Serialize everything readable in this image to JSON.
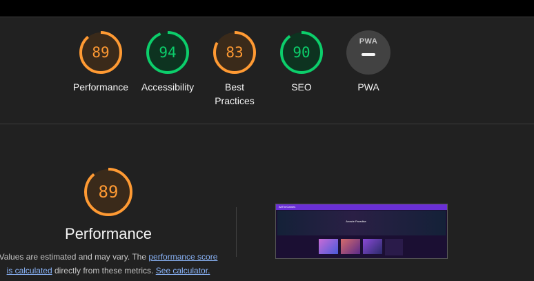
{
  "categories": [
    {
      "name": "performance",
      "score": "89",
      "label": "Performance",
      "color": "#ff9a33",
      "fraction": 0.89
    },
    {
      "name": "accessibility",
      "score": "94",
      "label": "Accessibility",
      "color": "#0cce6b",
      "fraction": 0.94
    },
    {
      "name": "best-practices",
      "score": "83",
      "label": "Best Practices",
      "color": "#ff9a33",
      "fraction": 0.83
    },
    {
      "name": "seo",
      "score": "90",
      "label": "SEO",
      "color": "#0cce6b",
      "fraction": 0.9
    }
  ],
  "pwa": {
    "badge_text": "PWA",
    "label": "PWA"
  },
  "performance": {
    "score": "89",
    "fraction": 0.89,
    "title": "Performance",
    "desc_part1": "Values are estimated and may vary. The ",
    "link1": "performance score is calculated",
    "desc_part2": " directly from these metrics. ",
    "link2": "See calculator."
  },
  "screenshot_preview": {
    "site_title": "AllTheGames",
    "hero_text": "Arcade Paradise"
  },
  "colors": {
    "average": "#ff9a33",
    "pass": "#0cce6b",
    "average_bg": "#3a2a1a",
    "pass_bg": "#0d3320"
  }
}
